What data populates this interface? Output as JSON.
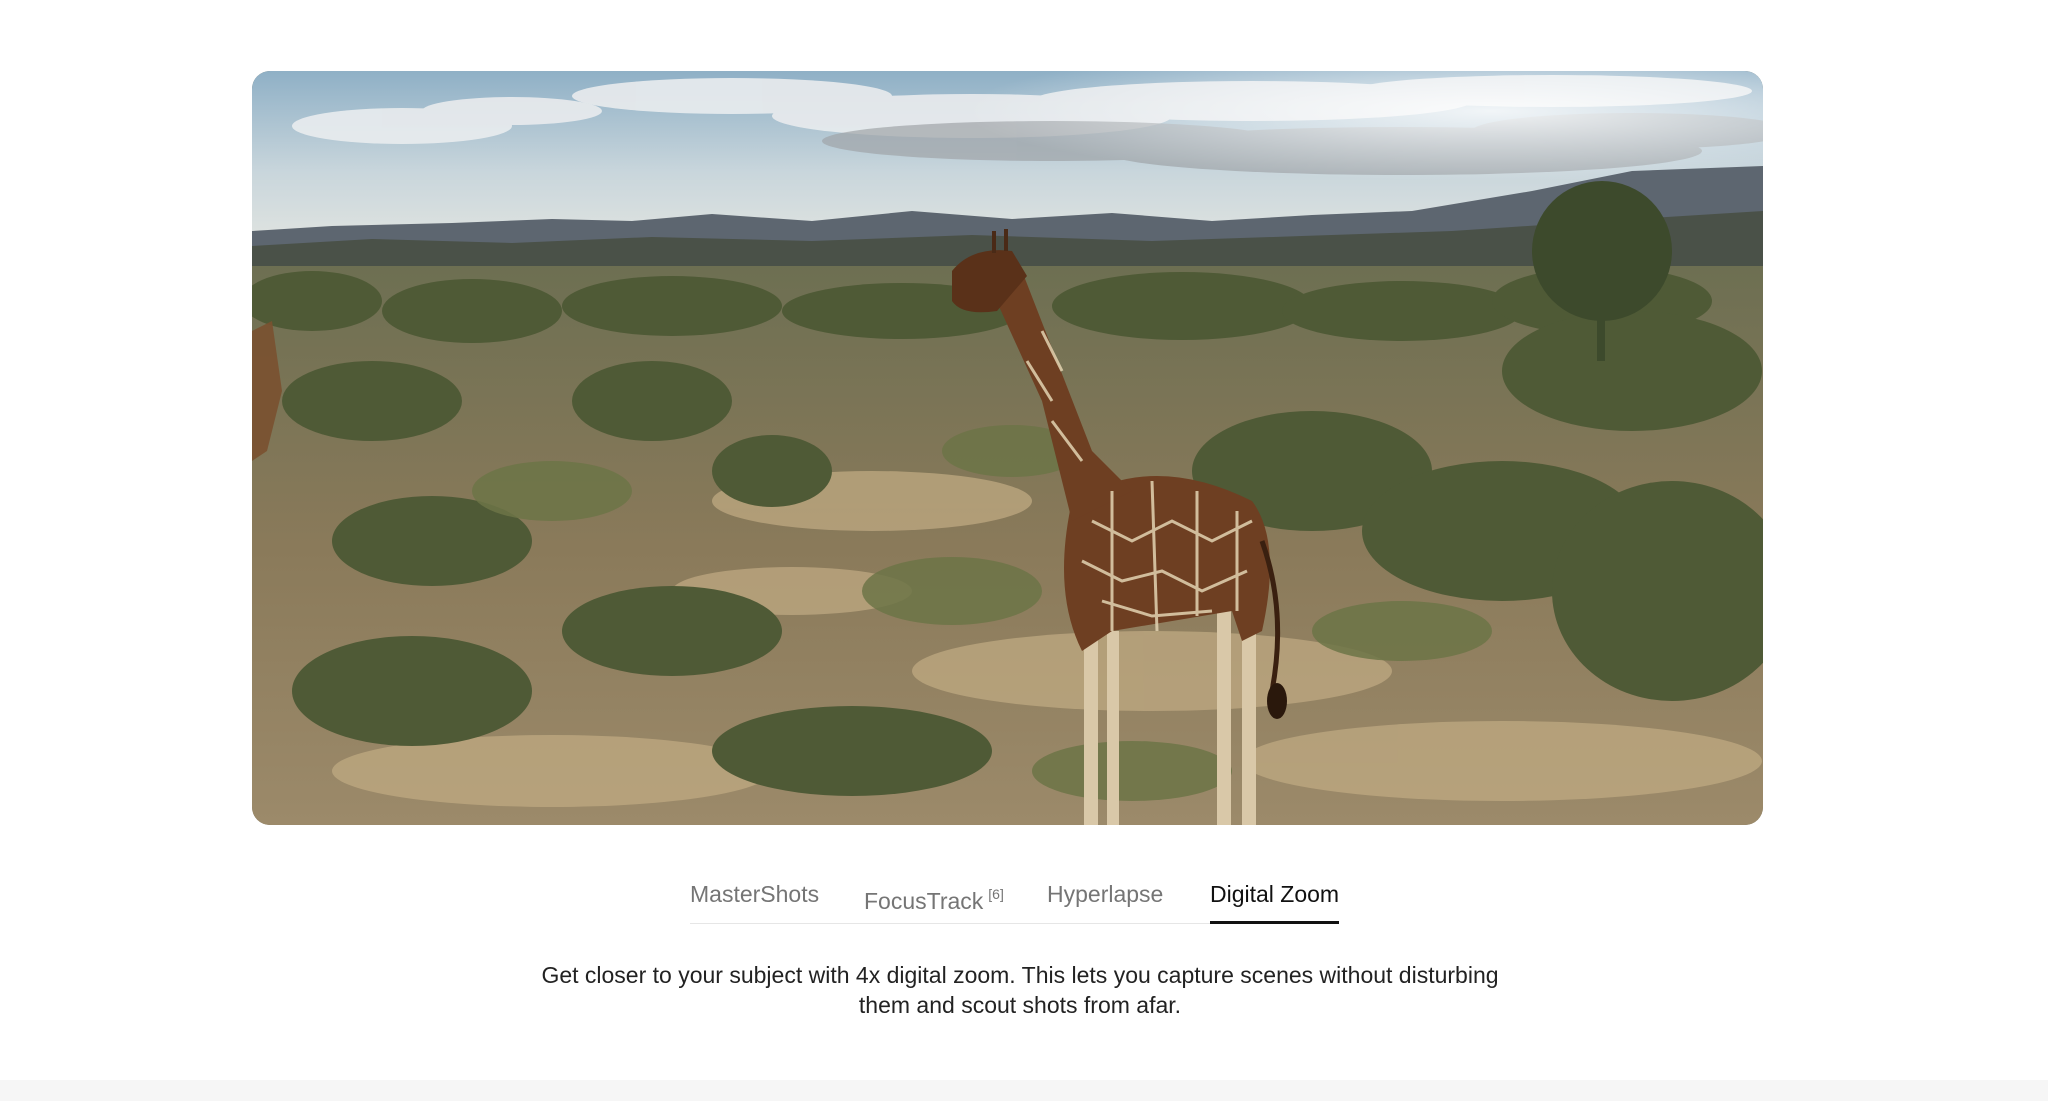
{
  "video": {
    "poster_description_icon": "giraffe-savanna-video"
  },
  "tabs": [
    {
      "label": "MasterShots",
      "active": false
    },
    {
      "label": "FocusTrack",
      "sup": "[6]",
      "active": false
    },
    {
      "label": "Hyperlapse",
      "active": false
    },
    {
      "label": "Digital Zoom",
      "active": true
    }
  ],
  "description": {
    "line1": "Get closer to your subject with 4x digital zoom. This lets you capture scenes without disturbing",
    "line2": "them and scout shots from afar."
  },
  "colors": {
    "active_tab": "#111111",
    "inactive_tab": "#757575",
    "divider": "#e6e6e6"
  }
}
